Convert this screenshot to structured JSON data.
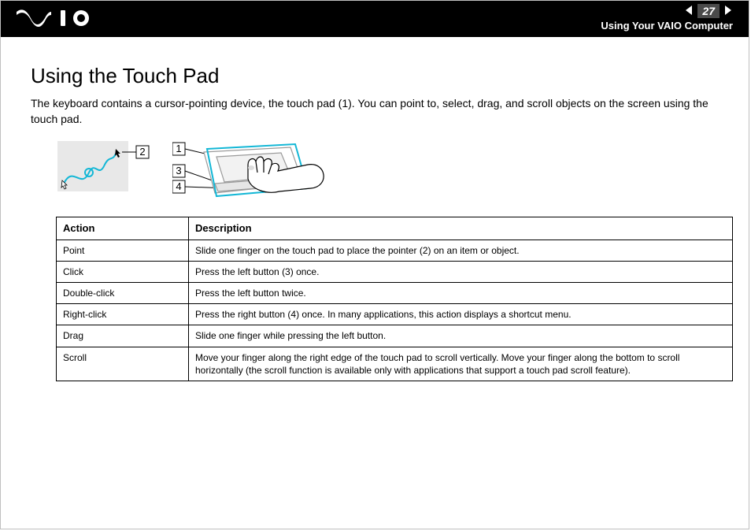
{
  "banner": {
    "page_number": "27",
    "subtitle": "Using Your VAIO Computer"
  },
  "heading": "Using the Touch Pad",
  "intro": "The keyboard contains a cursor-pointing device, the touch pad (1). You can point to, select, drag, and scroll objects on the screen using the touch pad.",
  "diagram": {
    "callouts_left": [
      "2"
    ],
    "callouts_right": [
      "1",
      "3",
      "4"
    ]
  },
  "table": {
    "headers": {
      "action": "Action",
      "description": "Description"
    },
    "rows": [
      {
        "action": "Point",
        "description": "Slide one finger on the touch pad to place the pointer (2) on an item or object."
      },
      {
        "action": "Click",
        "description": "Press the left button (3) once."
      },
      {
        "action": "Double-click",
        "description": "Press the left button twice."
      },
      {
        "action": "Right-click",
        "description": "Press the right button (4) once. In many applications, this action displays a shortcut menu."
      },
      {
        "action": "Drag",
        "description": "Slide one finger while pressing the left button."
      },
      {
        "action": "Scroll",
        "description": "Move your finger along the right edge of the touch pad to scroll vertically. Move your finger along the bottom to scroll horizontally (the scroll function is available only with applications that support a touch pad scroll feature)."
      }
    ]
  }
}
